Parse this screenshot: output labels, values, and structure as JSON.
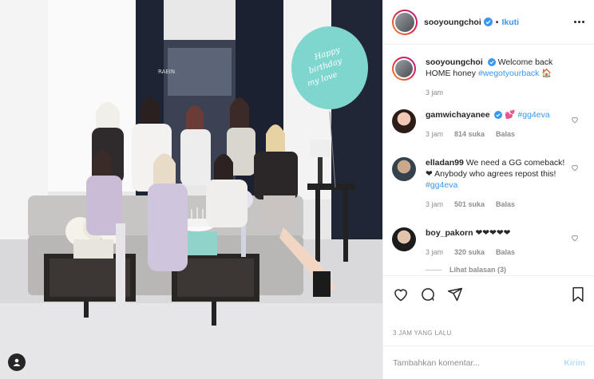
{
  "header": {
    "username": "sooyoungchoi",
    "separator": "•",
    "follow_label": "Ikuti"
  },
  "caption": {
    "username": "sooyoungchoi",
    "text": "Welcome back HOME honey",
    "hashtag": "#wegotyourback",
    "emoji": "🏠",
    "time": "3 jam"
  },
  "comments": [
    {
      "username": "gamwichayanee",
      "verified": true,
      "emoji": "💕",
      "hashtag": "#gg4eva",
      "time": "3 jam",
      "likes": "814 suka",
      "reply": "Balas"
    },
    {
      "username": "elladan99",
      "text": "We need a GG comeback!❤ Anybody who agrees repost this!",
      "hashtag": "#gg4eva",
      "time": "3 jam",
      "likes": "501 suka",
      "reply": "Balas"
    },
    {
      "username": "boy_pakorn",
      "text": "❤❤❤❤❤",
      "time": "3 jam",
      "likes": "320 suka",
      "reply": "Balas",
      "view_replies": "Lihat balasan (3)"
    }
  ],
  "post_time": "3 JAM YANG LALU",
  "add_comment": {
    "placeholder": "Tambahkan komentar...",
    "post_label": "Kirim"
  },
  "photo": {
    "balloon_text_1": "Happy",
    "balloon_text_2": "birthday",
    "balloon_text_3": "my love",
    "sign_text": "RAEIN"
  },
  "colors": {
    "accent": "#3897f0",
    "post_disabled": "#b2dffc",
    "muted": "#8e8e8e",
    "balloon": "#7fd6cf"
  }
}
